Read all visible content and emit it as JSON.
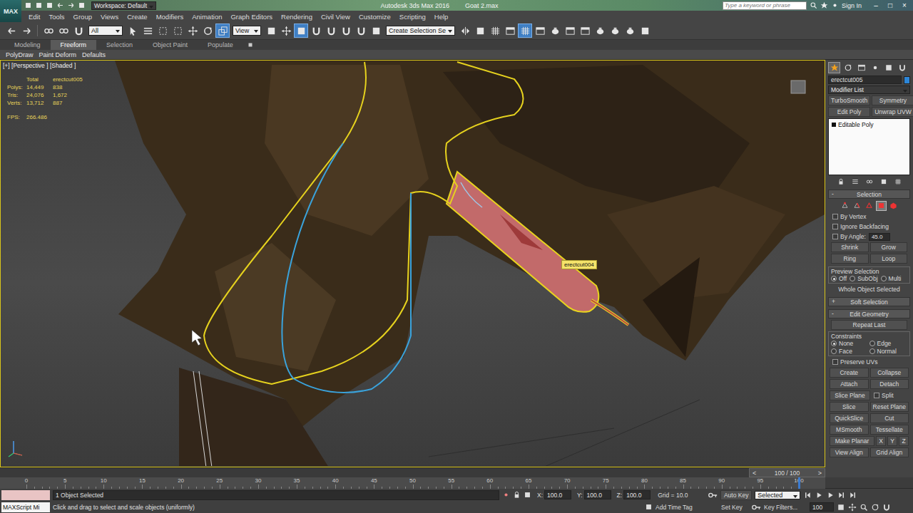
{
  "title_bar": {
    "logo": "MAX",
    "workspace": "Workspace: Default",
    "app_title": "Autodesk 3ds Max 2016",
    "file_name": "Goat 2.max",
    "search_placeholder": "Type a keyword or phrase",
    "sign_in": "Sign In",
    "window_controls": [
      "–",
      "□",
      "×"
    ]
  },
  "menu": [
    "Edit",
    "Tools",
    "Group",
    "Views",
    "Create",
    "Modifiers",
    "Animation",
    "Graph Editors",
    "Rendering",
    "Civil View",
    "Customize",
    "Scripting",
    "Help"
  ],
  "toolbar": {
    "selection_filter": "All",
    "reference_coordinate": "View",
    "named_selection": "Create Selection Se",
    "buttons": [
      {
        "selected": false
      },
      {
        "selected": false
      },
      {
        "selected": false
      },
      {
        "selected": false
      },
      {
        "selected": false
      },
      {
        "selected": false
      },
      {
        "selected": false
      },
      {
        "selected": false
      },
      {
        "selected": false
      },
      {
        "selected": false
      },
      {
        "selected": false
      },
      {
        "selected": true
      },
      {
        "selected": false
      },
      {
        "selected": false
      },
      {
        "selected": true
      },
      {
        "selected": false
      },
      {
        "selected": false
      },
      {
        "selected": false
      },
      {
        "selected": false
      },
      {
        "selected": false
      },
      {
        "selected": false
      },
      {
        "selected": false
      },
      {
        "selected": false
      },
      {
        "selected": false
      },
      {
        "selected": true
      },
      {
        "selected": false
      },
      {
        "selected": false
      },
      {
        "selected": false
      },
      {
        "selected": false
      },
      {
        "selected": false
      },
      {
        "selected": false
      },
      {
        "selected": false
      },
      {
        "selected": false
      }
    ]
  },
  "ribbon": {
    "tabs": [
      {
        "label": "Modeling",
        "selected": false
      },
      {
        "label": "Freeform",
        "selected": true
      },
      {
        "label": "Selection",
        "selected": false
      },
      {
        "label": "Object Paint",
        "selected": false
      },
      {
        "label": "Populate",
        "selected": false
      }
    ],
    "tools": [
      "PolyDraw",
      "Paint Deform",
      "Defaults"
    ]
  },
  "viewport": {
    "label": "[+] [Perspective ] [Shaded ]",
    "stats": {
      "headers": [
        "Total",
        "erectcut005"
      ],
      "rows": [
        {
          "label": "Polys:",
          "total": "14,449",
          "selection": "838"
        },
        {
          "label": "Tris:",
          "total": "24,076",
          "selection": "1,672"
        },
        {
          "label": "Verts:",
          "total": "13,712",
          "selection": "887"
        }
      ],
      "fps_label": "FPS:",
      "fps": "266.486"
    },
    "tooltip": "erectcut004"
  },
  "command_panel": {
    "tabs": [
      {
        "selected": true
      },
      {
        "selected": false
      },
      {
        "selected": false
      },
      {
        "selected": false
      },
      {
        "selected": false
      },
      {
        "selected": false
      }
    ],
    "object_name": "erectcut005",
    "modifier_list": "Modifier List",
    "modifier_buttons": [
      "TurboSmooth",
      "Symmetry",
      "Edit Poly",
      "Unwrap UVW"
    ],
    "stack": [
      {
        "label": "Editable Poly",
        "selected": false
      }
    ],
    "selection": {
      "title": "Selection",
      "collapse": "-",
      "subobject_levels": [
        {
          "selected": false
        },
        {
          "selected": false
        },
        {
          "selected": false
        },
        {
          "selected": true
        },
        {
          "selected": false
        }
      ],
      "options": [
        {
          "label": "By Vertex",
          "checked": false
        },
        {
          "label": "Ignore Backfacing",
          "checked": false
        },
        {
          "label": "By Angle:",
          "checked": false
        }
      ],
      "angle": "45.0",
      "buttons": [
        "Shrink",
        "Grow",
        "Ring",
        "Loop"
      ],
      "preview_title": "Preview Selection",
      "preview": [
        {
          "label": "Off",
          "selected": true
        },
        {
          "label": "SubObj",
          "selected": false
        },
        {
          "label": "Multi",
          "selected": false
        }
      ],
      "status": "Whole Object Selected"
    },
    "soft_selection": {
      "title": "Soft Selection",
      "collapse": "+"
    },
    "edit_geometry": {
      "title": "Edit Geometry",
      "collapse": "-",
      "repeat_last": "Repeat Last",
      "constraints_title": "Constraints",
      "constraints": [
        {
          "label": "None",
          "selected": true
        },
        {
          "label": "Edge",
          "selected": false
        },
        {
          "label": "Face",
          "selected": false
        },
        {
          "label": "Normal",
          "selected": false
        }
      ],
      "preserve_uvs": {
        "label": "Preserve UVs",
        "checked": false
      },
      "rows": [
        [
          {
            "label": "Create",
            "kind": "button",
            "checked": false
          },
          {
            "label": "Collapse",
            "kind": "button",
            "checked": false
          }
        ],
        [
          {
            "label": "Attach",
            "kind": "button",
            "checked": false
          },
          {
            "label": "Detach",
            "kind": "button",
            "checked": false
          }
        ],
        [
          {
            "label": "Slice Plane",
            "kind": "button",
            "checked": false
          },
          {
            "label": "Split",
            "kind": "checkbox",
            "checked": false
          }
        ],
        [
          {
            "label": "Slice",
            "kind": "button",
            "checked": false
          },
          {
            "label": "Reset Plane",
            "kind": "button",
            "checked": false
          }
        ],
        [
          {
            "label": "QuickSlice",
            "kind": "button",
            "checked": false
          },
          {
            "label": "Cut",
            "kind": "button",
            "checked": false
          }
        ],
        [
          {
            "label": "MSmooth",
            "kind": "button",
            "checked": false
          },
          {
            "label": "Tessellate",
            "kind": "button",
            "checked": false
          }
        ],
        [
          {
            "label": "Make Planar",
            "kind": "button",
            "checked": false
          },
          {
            "label": "X",
            "kind": "button",
            "checked": false
          },
          {
            "label": "Y",
            "kind": "button",
            "checked": false
          },
          {
            "label": "Z",
            "kind": "button",
            "checked": false
          }
        ],
        [
          {
            "label": "View Align",
            "kind": "button",
            "checked": false
          },
          {
            "label": "Grid Align",
            "kind": "button",
            "checked": false
          }
        ]
      ]
    }
  },
  "timeline": {
    "prev": "<",
    "position": "100 / 100",
    "next": ">",
    "level": 1,
    "ticks": [
      "0",
      "5",
      "10",
      "15",
      "20",
      "25",
      "30",
      "35",
      "40",
      "45",
      "50",
      "55",
      "60",
      "65",
      "70",
      "75",
      "80",
      "85",
      "90",
      "95",
      "100"
    ]
  },
  "status_bar": {
    "listener": "MAXScript Mi",
    "selection": "1 Object Selected",
    "prompt": "Click and drag to select and scale objects (uniformly)",
    "coords": [
      {
        "axis": "X:",
        "value": "100.0"
      },
      {
        "axis": "Y:",
        "value": "100.0"
      },
      {
        "axis": "Z:",
        "value": "100.0"
      }
    ],
    "grid": "Grid = 10.0",
    "add_time_tag": "Add Time Tag",
    "auto_key": "Auto Key",
    "key_mode": "Selected",
    "set_key": "Set Key",
    "key_filters": "Key Filters...",
    "frame": "100"
  }
}
